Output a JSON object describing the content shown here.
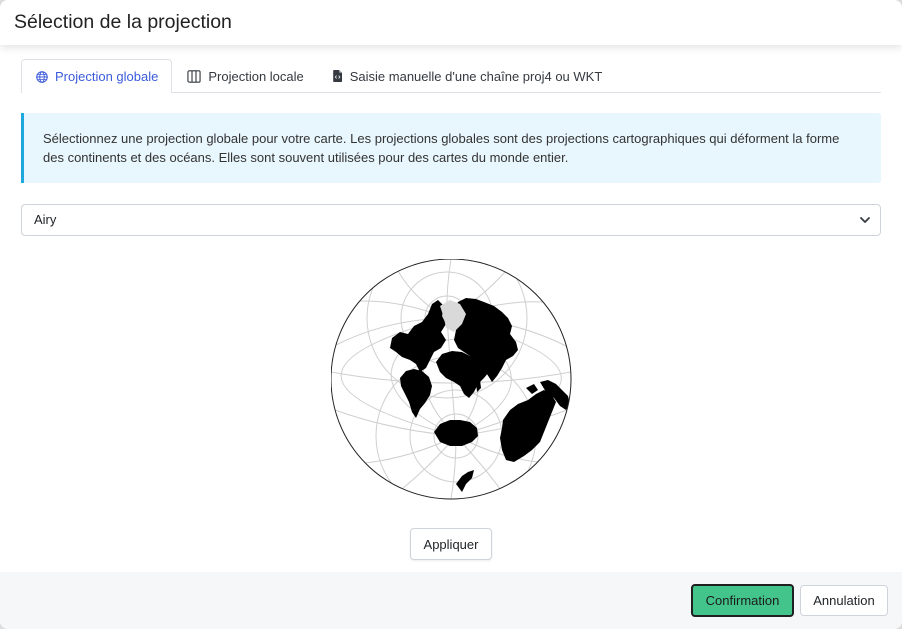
{
  "dialog": {
    "title": "Sélection de la projection"
  },
  "tabs": [
    {
      "label": "Projection globale",
      "icon": "globe-icon",
      "active": true
    },
    {
      "label": "Projection locale",
      "icon": "map-icon",
      "active": false
    },
    {
      "label": "Saisie manuelle d'une chaîne proj4 ou WKT",
      "icon": "file-code-icon",
      "active": false
    }
  ],
  "info_alert": {
    "text": "Sélectionnez une projection globale pour votre carte. Les projections globales sont des projections cartographiques qui déforment la forme des continents et des océans. Elles sont souvent utilisées pour des cartes du monde entier."
  },
  "projection_select": {
    "value": "Airy",
    "icon": "chevron-down-icon"
  },
  "actions": {
    "apply": "Appliquer",
    "confirm": "Confirmation",
    "cancel": "Annulation"
  },
  "colors": {
    "accent": "#3b5bdb",
    "info_border": "#1ea7df",
    "info_bg": "#e8f6fd",
    "confirm_bg": "#43c48b",
    "footer_bg": "#f6f7f9"
  }
}
